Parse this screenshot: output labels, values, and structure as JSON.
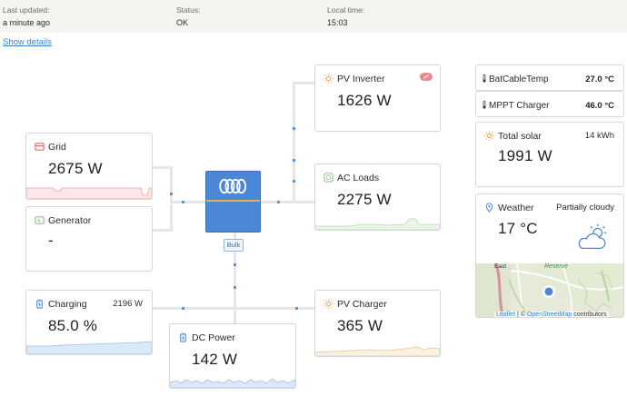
{
  "header": {
    "last_updated_label": "Last updated:",
    "last_updated_value": "a minute ago",
    "status_label": "Status:",
    "status_value": "OK",
    "local_time_label": "Local time:",
    "local_time_value": "15:03"
  },
  "show_details": "Show details",
  "grid": {
    "title": "Grid",
    "value": "2675 W"
  },
  "generator": {
    "title": "Generator",
    "value": "-"
  },
  "battery": {
    "title": "Charging",
    "power": "2196 W",
    "value": "85.0 %"
  },
  "dc_power": {
    "title": "DC Power",
    "value": "142 W"
  },
  "pv_inverter": {
    "title": "PV Inverter",
    "value": "1626 W"
  },
  "ac_loads": {
    "title": "AC Loads",
    "value": "2275 W"
  },
  "pv_charger": {
    "title": "PV Charger",
    "value": "365 W"
  },
  "inverter": {
    "state": "Bulk"
  },
  "temps": [
    {
      "title": "BatCableTemp",
      "value": "27.0 °C"
    },
    {
      "title": "MPPT Charger",
      "value": "46.0 °C"
    }
  ],
  "total_solar": {
    "title": "Total solar",
    "energy": "14 kWh",
    "value": "1991 W"
  },
  "weather": {
    "title": "Weather",
    "condition": "Partially cloudy",
    "value": "17 °C",
    "map_label_east": "East",
    "map_label_reserve": "Reserve",
    "map_attr_leaflet": "Leaflet",
    "map_attr_sep": " | © ",
    "map_attr_osm": "OpenStreetMap",
    "map_attr_contrib": " contributors"
  },
  "colors": {
    "accent_blue": "#4a88d6",
    "grid_red": "#e26b6b",
    "solar_orange": "#e9a64a",
    "loads_green": "#8cc88c",
    "link": "#3b82c4"
  }
}
